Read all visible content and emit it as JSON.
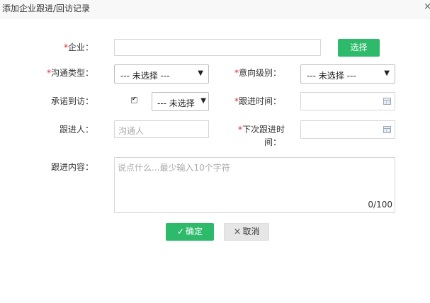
{
  "dialog": {
    "title": "添加企业跟进/回访记录",
    "close_glyph": "×"
  },
  "form": {
    "required_mark": "*",
    "enterprise": {
      "label": "企业：",
      "select_button": "选择",
      "value": ""
    },
    "comm_type": {
      "label": "沟通类型：",
      "selected": "--- 未选择 ---",
      "arrow": "▼"
    },
    "intent_level": {
      "label": "意向级别：",
      "selected": "--- 未选择 ---",
      "arrow": "▼"
    },
    "promise_visit": {
      "label": "承诺到访：",
      "checked": true,
      "selected": "--- 未选择",
      "arrow": "▼"
    },
    "follow_time": {
      "label": "跟进时间：",
      "value": ""
    },
    "follower": {
      "label": "跟进人：",
      "placeholder": "沟通人"
    },
    "next_follow_time": {
      "label_line1": "下次跟进时",
      "label_line2": "间：",
      "value": ""
    },
    "content": {
      "label": "跟进内容：",
      "placeholder": "说点什么...最少输入10个字符",
      "counter": "0/100"
    }
  },
  "actions": {
    "confirm": {
      "label": "确定",
      "icon": "check-icon"
    },
    "cancel": {
      "label": "取消",
      "icon": "close-icon"
    }
  },
  "colors": {
    "primary_green": "#2dbb6b",
    "required_red": "#e0292c"
  }
}
